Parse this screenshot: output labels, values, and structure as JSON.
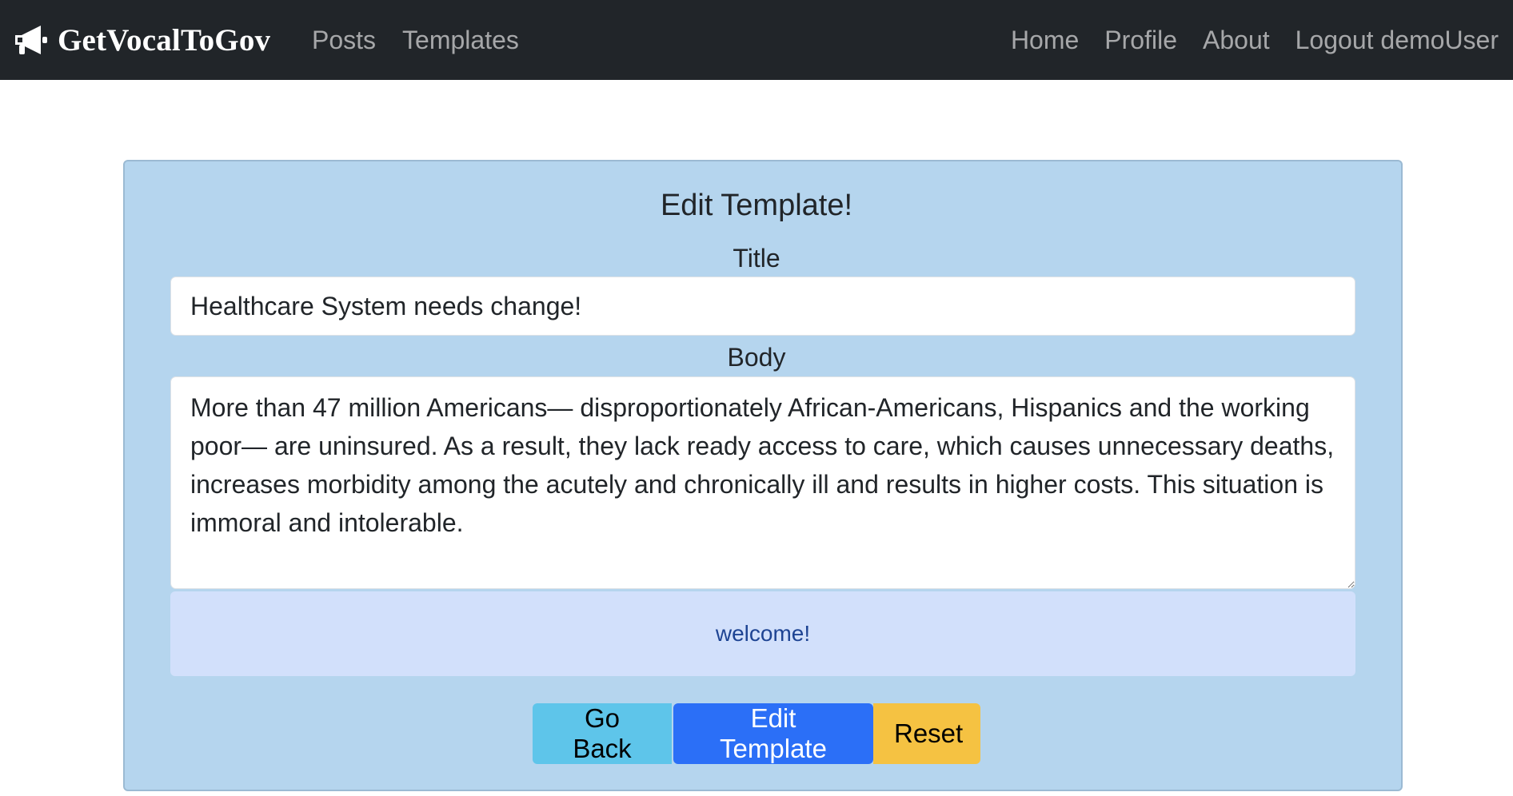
{
  "navbar": {
    "brand": "GetVocalToGov",
    "brand_icon": "megaphone-icon",
    "left_links": [
      "Posts",
      "Templates"
    ],
    "right_links": [
      "Home",
      "Profile",
      "About",
      "Logout demoUser"
    ]
  },
  "form": {
    "heading": "Edit Template!",
    "title_label": "Title",
    "title_value": "Healthcare System needs change!",
    "body_label": "Body",
    "body_value": "More than 47 million Americans— disproportionately African-Americans, Hispanics and the working poor— are uninsured. As a result, they lack ready access to care, which causes unnecessary deaths, increases morbidity among the acutely and chronically ill and results in higher costs. This situation is immoral and intolerable.",
    "alert_message": "welcome!"
  },
  "buttons": {
    "go_back": "Go Back",
    "edit_template": "Edit Template",
    "reset": "Reset"
  },
  "colors": {
    "navbar_bg": "#212529",
    "card_bg": "#b5d5ee",
    "alert_bg": "#d2e0fb",
    "go_back_btn": "#5ec5ea",
    "edit_btn": "#2b6ff7",
    "reset_btn": "#f5c242"
  }
}
